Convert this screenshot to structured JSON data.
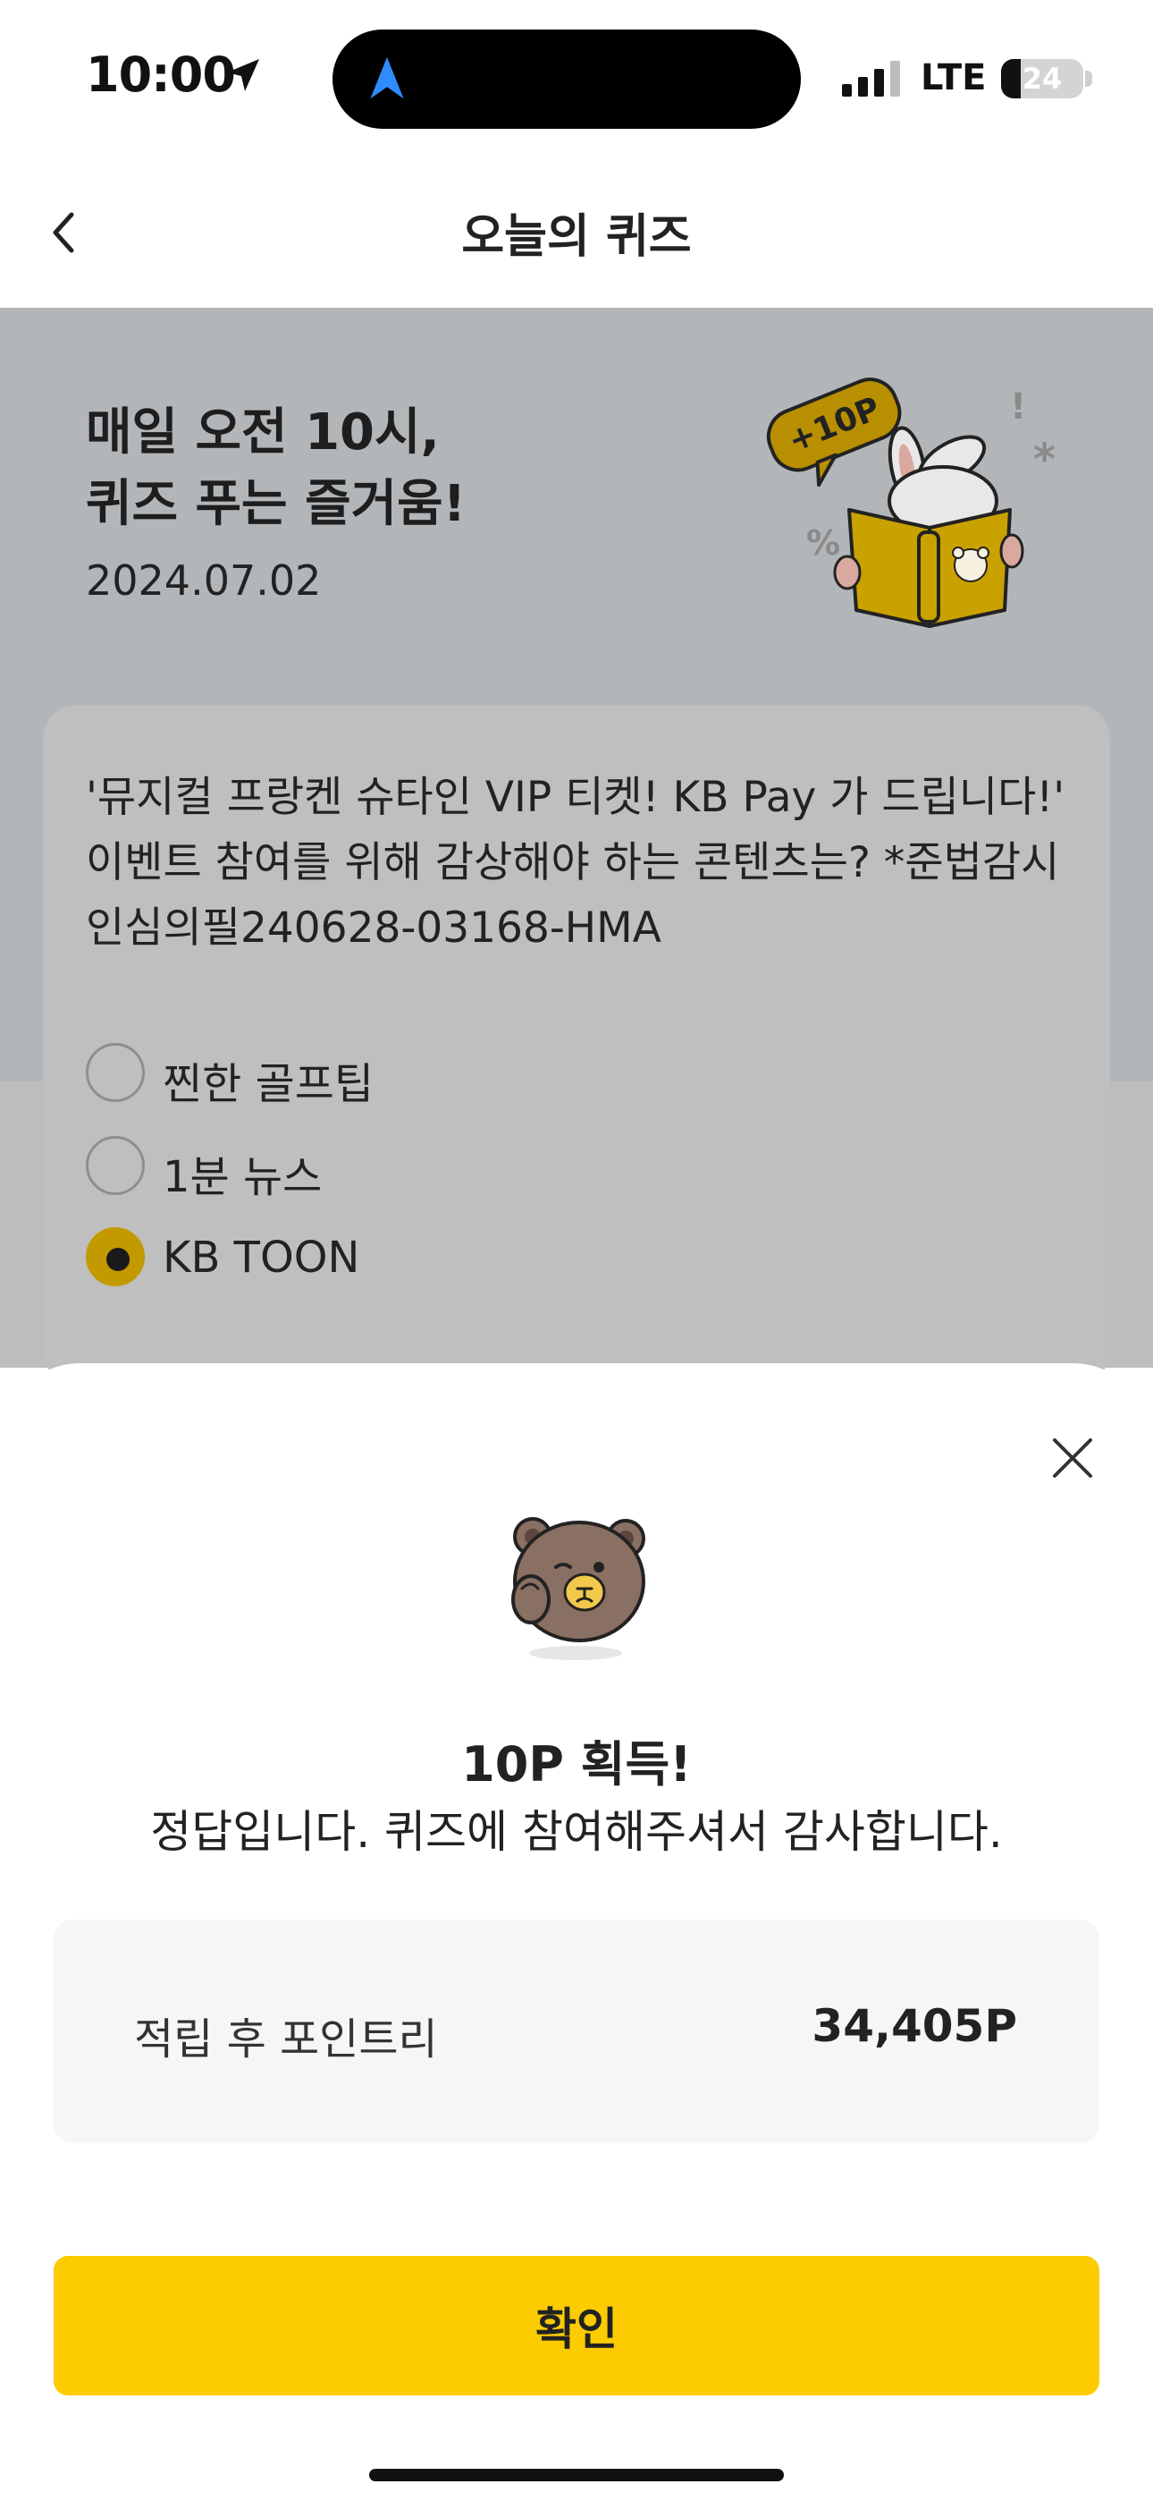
{
  "status_bar": {
    "time": "10:00",
    "network": "LTE",
    "battery": "24"
  },
  "header": {
    "title": "오늘의 퀴즈"
  },
  "hero": {
    "title_line1": "매일 오전 10시,",
    "title_line2": "퀴즈 푸는 즐거움!",
    "date": "2024.07.02",
    "badge": "+10P"
  },
  "quiz": {
    "question": "'뮤지컬 프랑켄 슈타인 VIP 티켓! KB Pay 가 드립니다!' 이벤트 참여를 위해 감상해야 하는 콘텐츠는? *준법감시인심의필240628-03168-HMA",
    "options": [
      {
        "label": "찐한 골프팁",
        "selected": false
      },
      {
        "label": "1분 뉴스",
        "selected": false
      },
      {
        "label": "KB TOON",
        "selected": true
      }
    ]
  },
  "result_sheet": {
    "title": "10P 획득!",
    "message": "정답입니다. 퀴즈에 참여해주셔서 감사합니다.",
    "points_label": "적립 후 포인트리",
    "points_value": "34,405P",
    "confirm_label": "확인"
  },
  "colors": {
    "accent": "#fccb00",
    "selected_radio": "#c29a00",
    "dim_overlay": "#b3b6b9"
  },
  "icons": [
    "location-arrow-icon",
    "navigation-icon",
    "signal-icon",
    "battery-icon",
    "back-chevron-icon",
    "close-icon",
    "bear-character-icon",
    "rabbit-reading-illustration"
  ]
}
